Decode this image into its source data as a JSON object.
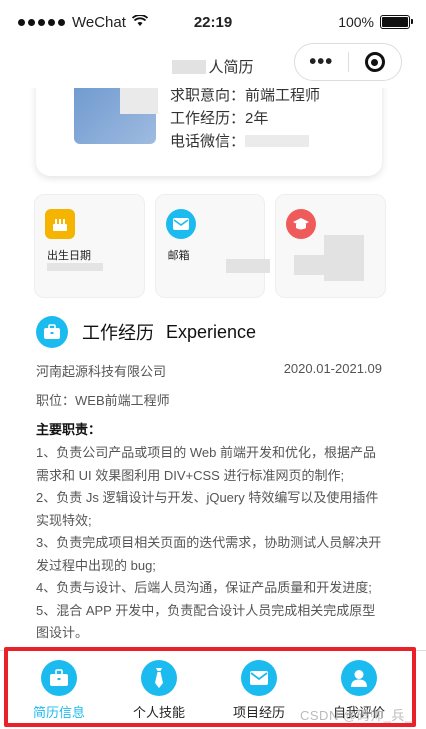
{
  "status_bar": {
    "carrier": "WeChat",
    "time": "22:19",
    "battery": "100%"
  },
  "nav": {
    "title": "人简历"
  },
  "profile": {
    "intent_label": "求职意向：",
    "intent_value": "前端工程师",
    "experience_label": "工作经历：",
    "experience_value": "2年",
    "contact_label": "电话微信："
  },
  "tiles": [
    {
      "label": "出生日期",
      "icon": "cake-icon",
      "color": "#f4b400"
    },
    {
      "label": "邮箱",
      "icon": "mail-icon",
      "color": "#1cbbef"
    },
    {
      "label": "",
      "icon": "graduation-cap-icon",
      "color": "#ef5a5a"
    }
  ],
  "work": {
    "title": "工作经历",
    "title_en": "Experience",
    "company": "河南起源科技有限公司",
    "period": "2020.01-2021.09",
    "position": "职位：WEB前端工程师",
    "duty_title": "主要职责：",
    "duties": [
      "1、负责公司产品或项目的 Web 前端开发和优化，根据产品需求和 UI 效果图利用 DIV+CSS 进行标准网页的制作;",
      "2、负责 Js 逻辑设计与开发、jQuery 特效编写以及使用插件实现特效;",
      "3、负责完成项目相关页面的迭代需求，协助测试人员解决开发过程中出现的 bug;",
      "4、负责与设计、后端人员沟通，保证产品质量和开发进度;",
      "5、混合 APP 开发中，负责配合设计人员完成相关完成原型图设计。"
    ]
  },
  "tabbar": {
    "items": [
      {
        "label": "简历信息",
        "icon": "briefcase-icon",
        "active": true
      },
      {
        "label": "个人技能",
        "icon": "tie-icon",
        "active": false
      },
      {
        "label": "项目经历",
        "icon": "envelope-icon",
        "active": false
      },
      {
        "label": "自我评价",
        "icon": "user-icon",
        "active": false
      }
    ]
  },
  "watermark": "CSDN @码帅_兵_",
  "colors": {
    "accent": "#1cbbef",
    "highlight_frame": "#e8212b"
  }
}
